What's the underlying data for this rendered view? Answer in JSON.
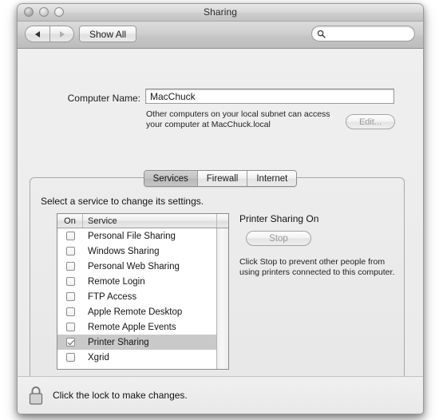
{
  "window": {
    "title": "Sharing",
    "traffic_lights": [
      "close-button",
      "minimize-button",
      "zoom-button"
    ]
  },
  "toolbar": {
    "back_label": "",
    "forward_label": "",
    "show_all_label": "Show All",
    "search": {
      "value": "",
      "placeholder": "",
      "icon": "search-icon"
    }
  },
  "computer_name": {
    "label": "Computer Name:",
    "value": "MacChuck",
    "placeholder": "",
    "note": "Other computers on your local subnet can access your computer at MacChuck.local",
    "edit_label": "Edit..."
  },
  "tabs": [
    {
      "label": "Services",
      "active": true
    },
    {
      "label": "Firewall",
      "active": false
    },
    {
      "label": "Internet",
      "active": false
    }
  ],
  "services_pane": {
    "hint": "Select a service to change its settings.",
    "columns": [
      "On",
      "Service"
    ],
    "rows": [
      {
        "service": "Personal File Sharing",
        "on": false,
        "selected": false
      },
      {
        "service": "Windows Sharing",
        "on": false,
        "selected": false
      },
      {
        "service": "Personal Web Sharing",
        "on": false,
        "selected": false
      },
      {
        "service": "Remote Login",
        "on": false,
        "selected": false
      },
      {
        "service": "FTP Access",
        "on": false,
        "selected": false
      },
      {
        "service": "Apple Remote Desktop",
        "on": false,
        "selected": false
      },
      {
        "service": "Remote Apple Events",
        "on": false,
        "selected": false
      },
      {
        "service": "Printer Sharing",
        "on": true,
        "selected": true
      },
      {
        "service": "Xgrid",
        "on": false,
        "selected": false
      }
    ]
  },
  "detail": {
    "title": "Printer Sharing On",
    "action_label": "Stop",
    "note": "Click Stop to prevent other people from using printers connected to this computer."
  },
  "help": {
    "label": "?"
  },
  "lock": {
    "icon": "lock-closed-icon",
    "text": "Click the lock to make changes."
  },
  "colors": {
    "selection": "#c9c9c9",
    "window_bg": "#ededed",
    "titlebar": "#cfcfcf"
  }
}
